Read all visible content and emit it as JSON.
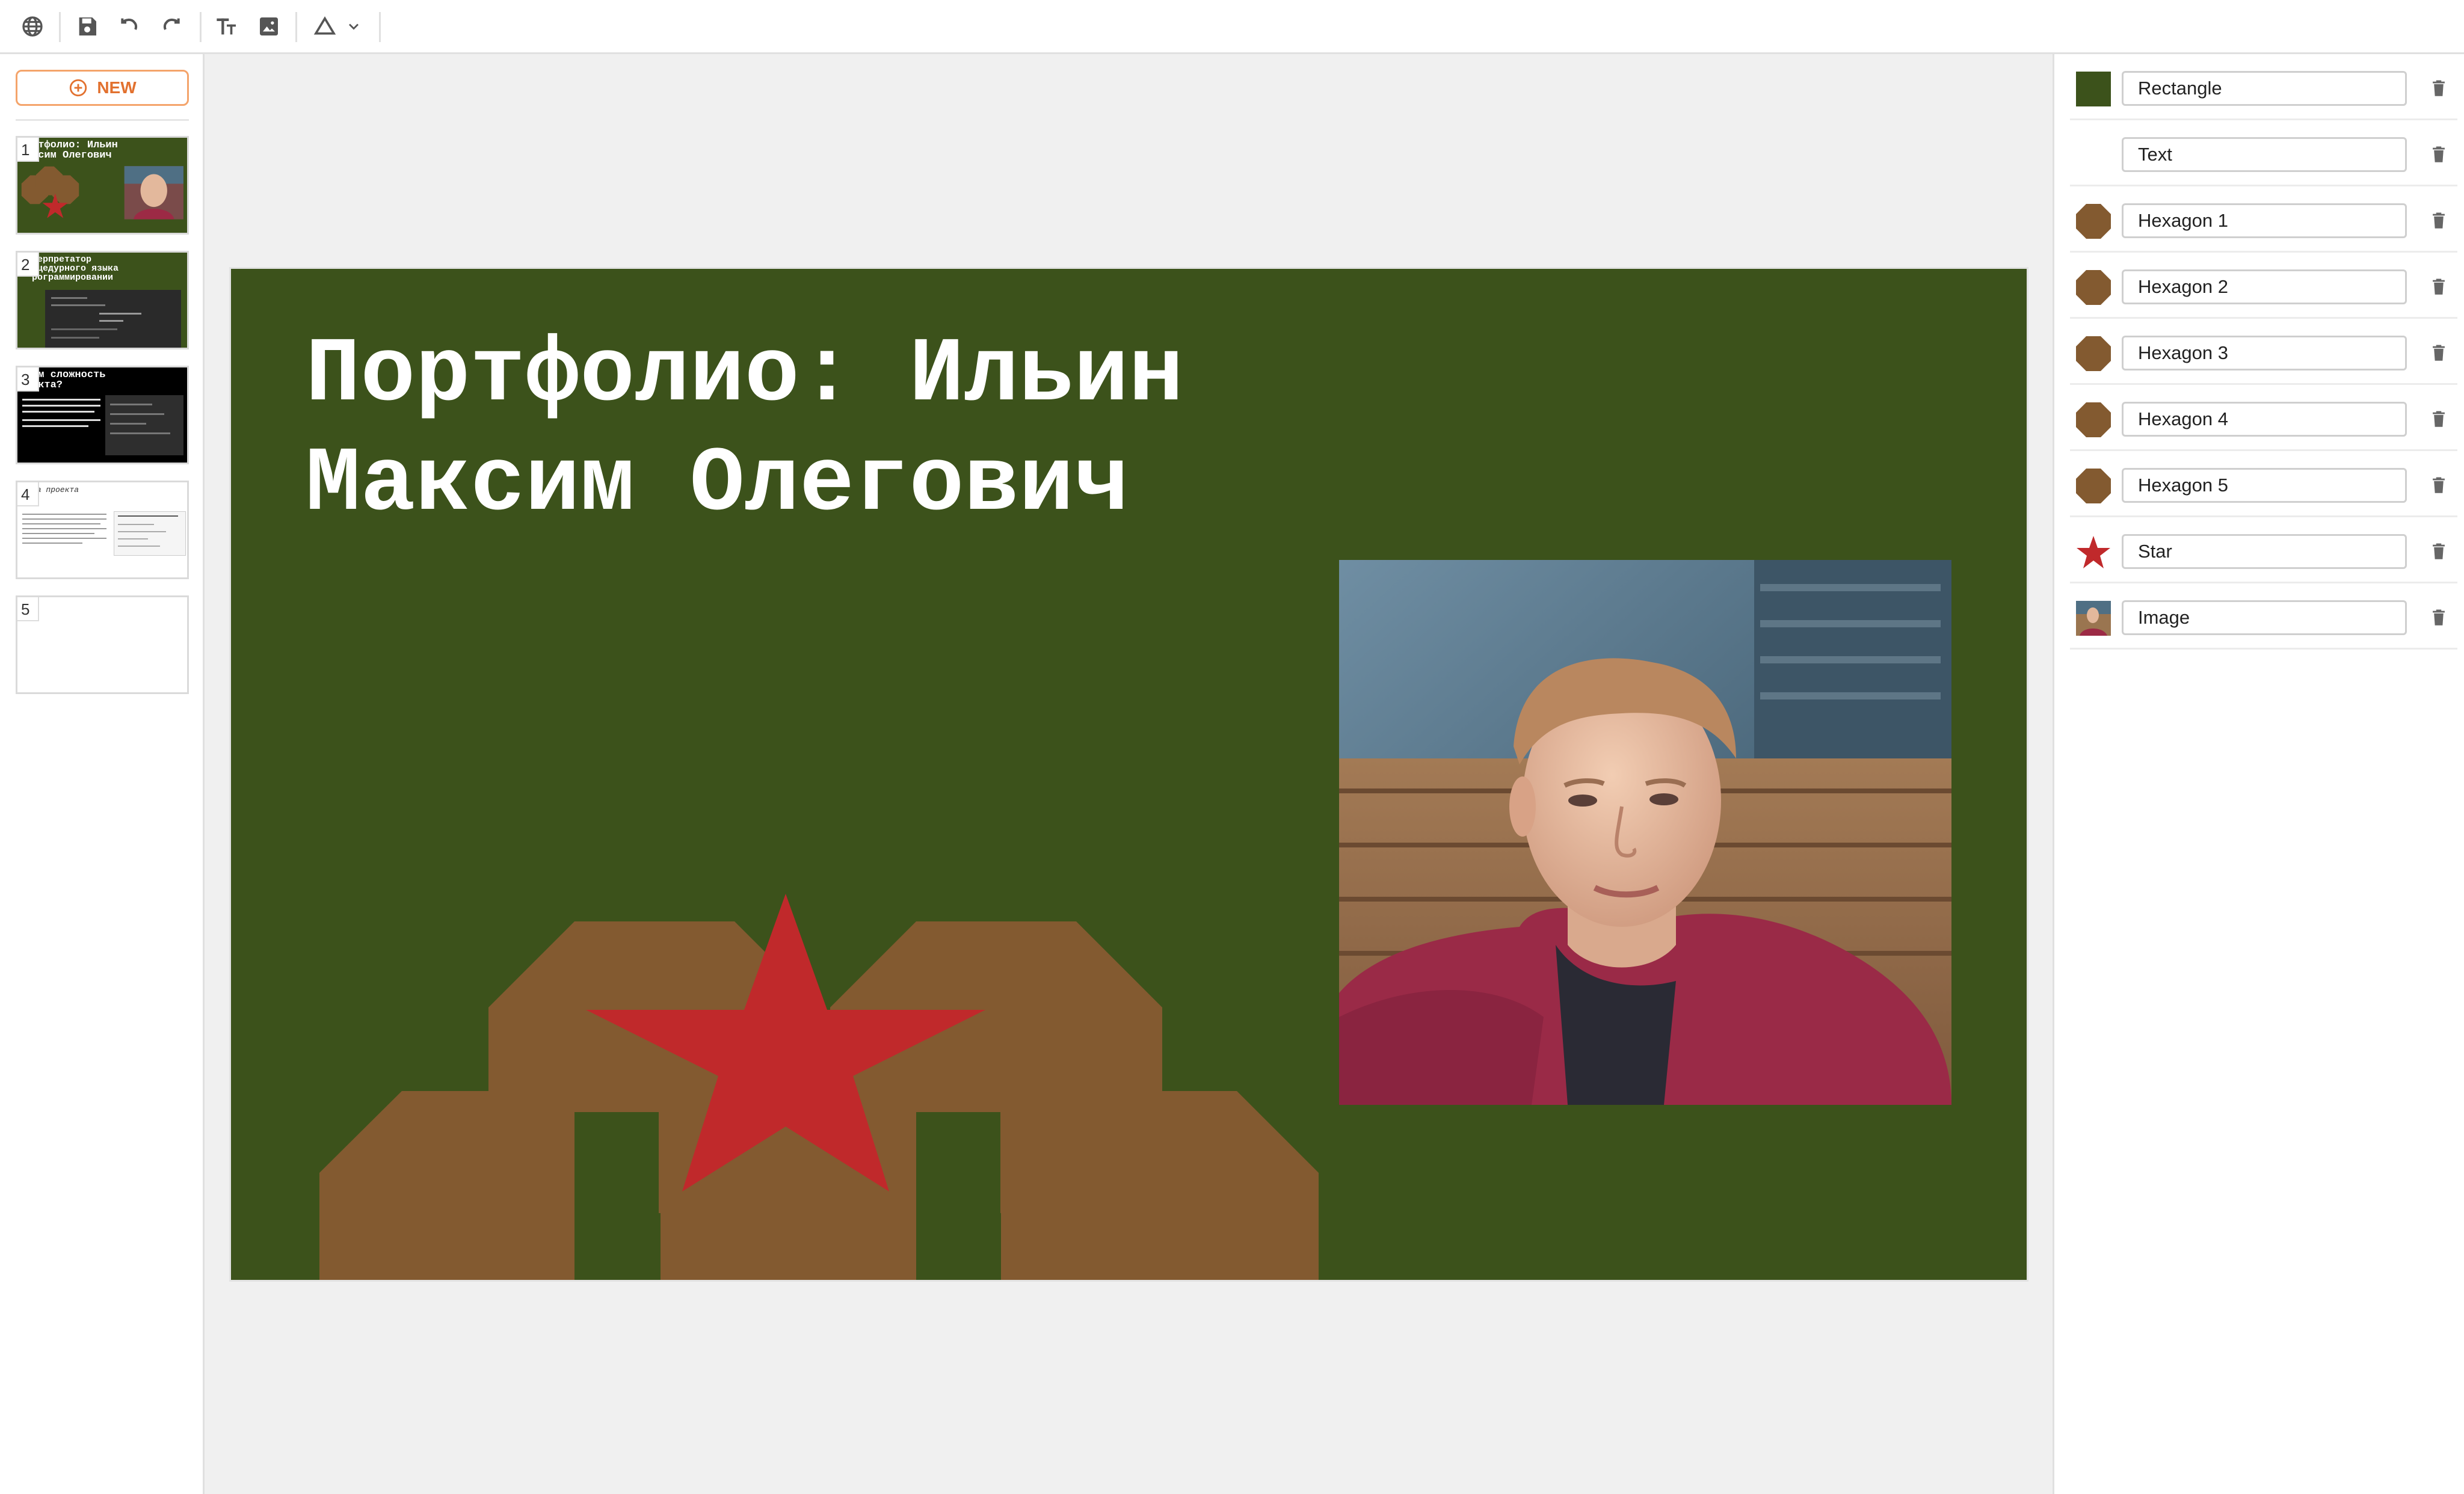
{
  "toolbar": {
    "icons": [
      "globe-icon",
      "save-icon",
      "undo-icon",
      "redo-icon",
      "text-icon",
      "image-icon",
      "shape-icon",
      "chevron-down-icon"
    ],
    "icon_color": "#555555"
  },
  "sidebar": {
    "new_button_label": "NEW",
    "accent_color": "#e2712f",
    "slides": [
      {
        "number": "1",
        "title": "ртфолио: Ильин\nксим Олегович",
        "background": "#3c521b"
      },
      {
        "number": "2",
        "title": "терпретатор\nоцедурного языка\nрограммировании",
        "background": "#3c521b"
      },
      {
        "number": "3",
        "title": "ем сложность\nекта?",
        "background": "#000000"
      },
      {
        "number": "4",
        "title": "за проекта",
        "background": "#ffffff"
      },
      {
        "number": "5",
        "title": "",
        "background": "#ffffff"
      }
    ]
  },
  "slide": {
    "title": "Портфолио: Ильин\nМаксим Олегович",
    "background_color": "#3c521b",
    "hexagon_color": "#835a30",
    "star_color": "#c0292b",
    "image_alt": "Photo of a young man in a red hoodie"
  },
  "layers": {
    "items": [
      {
        "name": "Rectangle",
        "icon": "rectangle-swatch",
        "color": "#3c521b"
      },
      {
        "name": "Text",
        "icon": "none",
        "color": ""
      },
      {
        "name": "Hexagon 1",
        "icon": "hexagon-swatch",
        "color": "#835a30"
      },
      {
        "name": "Hexagon 2",
        "icon": "hexagon-swatch",
        "color": "#835a30"
      },
      {
        "name": "Hexagon 3",
        "icon": "hexagon-swatch",
        "color": "#835a30"
      },
      {
        "name": "Hexagon 4",
        "icon": "hexagon-swatch",
        "color": "#835a30"
      },
      {
        "name": "Hexagon 5",
        "icon": "hexagon-swatch",
        "color": "#835a30"
      },
      {
        "name": "Star",
        "icon": "star-swatch",
        "color": "#c0292b"
      },
      {
        "name": "Image",
        "icon": "image-thumbnail",
        "color": ""
      }
    ],
    "delete_icon": "trash-icon"
  }
}
